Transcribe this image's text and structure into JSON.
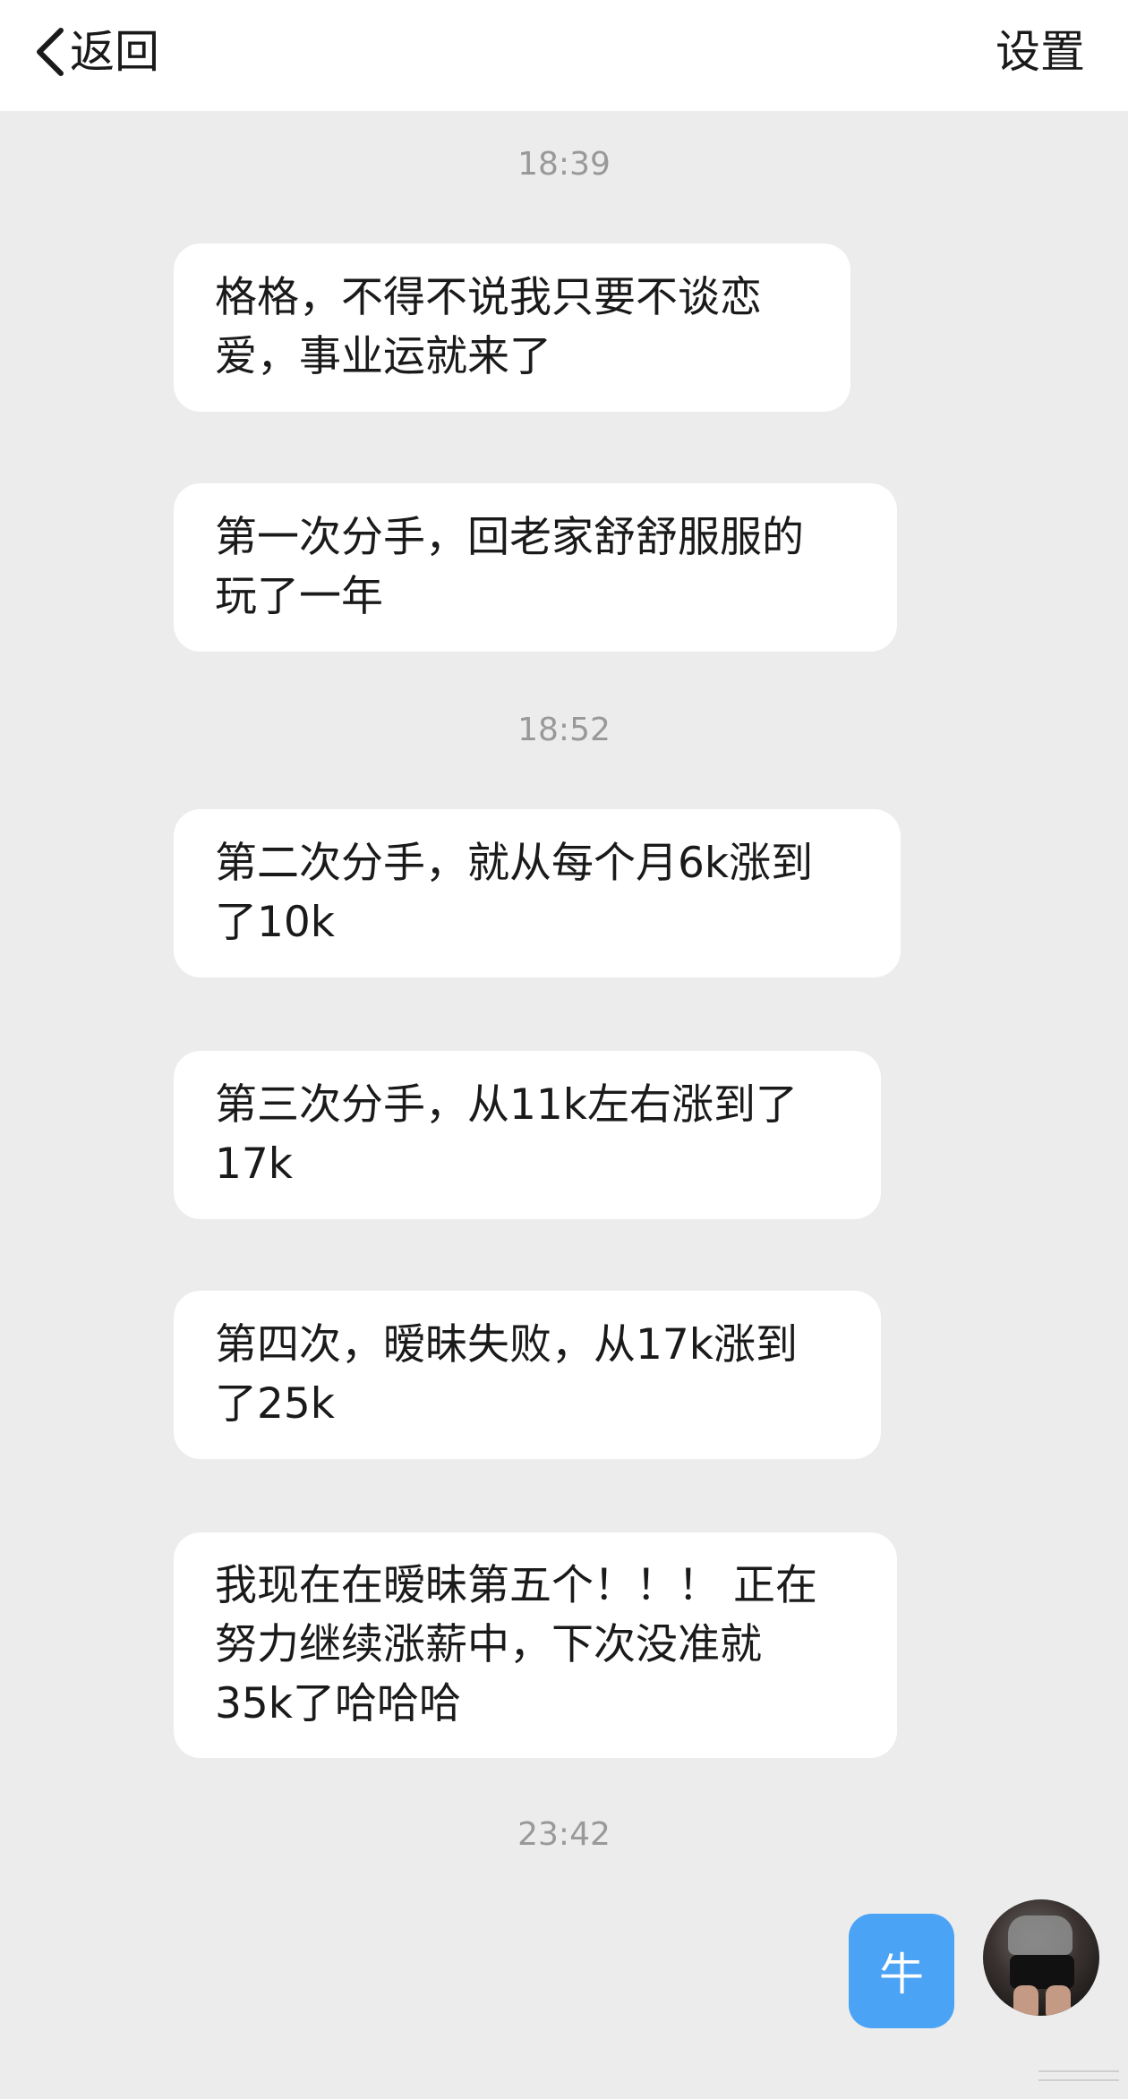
{
  "header": {
    "back_label": "返回",
    "settings_label": "设置"
  },
  "messages": [
    {
      "type": "time",
      "text": "18:39"
    },
    {
      "type": "in",
      "text": "格格，不得不说我只要不谈恋\n爱，事业运就来了"
    },
    {
      "type": "in",
      "text": "第一次分手，回老家舒舒服服的\n玩了一年"
    },
    {
      "type": "time",
      "text": "18:52"
    },
    {
      "type": "in",
      "text": "第二次分手，就从每个月6k涨到\n了10k"
    },
    {
      "type": "in",
      "text": "第三次分手，从11k左右涨到了\n17k"
    },
    {
      "type": "in",
      "text": "第四次，暧昧失败，从17k涨到\n了25k"
    },
    {
      "type": "in",
      "text": "我现在在暧昧第五个！！！ 正在\n努力继续涨薪中，下次没准就\n35k了哈哈哈"
    },
    {
      "type": "time",
      "text": "23:42"
    },
    {
      "type": "out",
      "text": "牛"
    }
  ],
  "colors": {
    "background": "#ececec",
    "header_bg": "#ffffff",
    "bubble_in": "#ffffff",
    "bubble_out": "#4aa3f5",
    "timestamp": "#999999"
  },
  "icons": {
    "back": "chevron-left-icon",
    "avatar": "user-avatar"
  }
}
